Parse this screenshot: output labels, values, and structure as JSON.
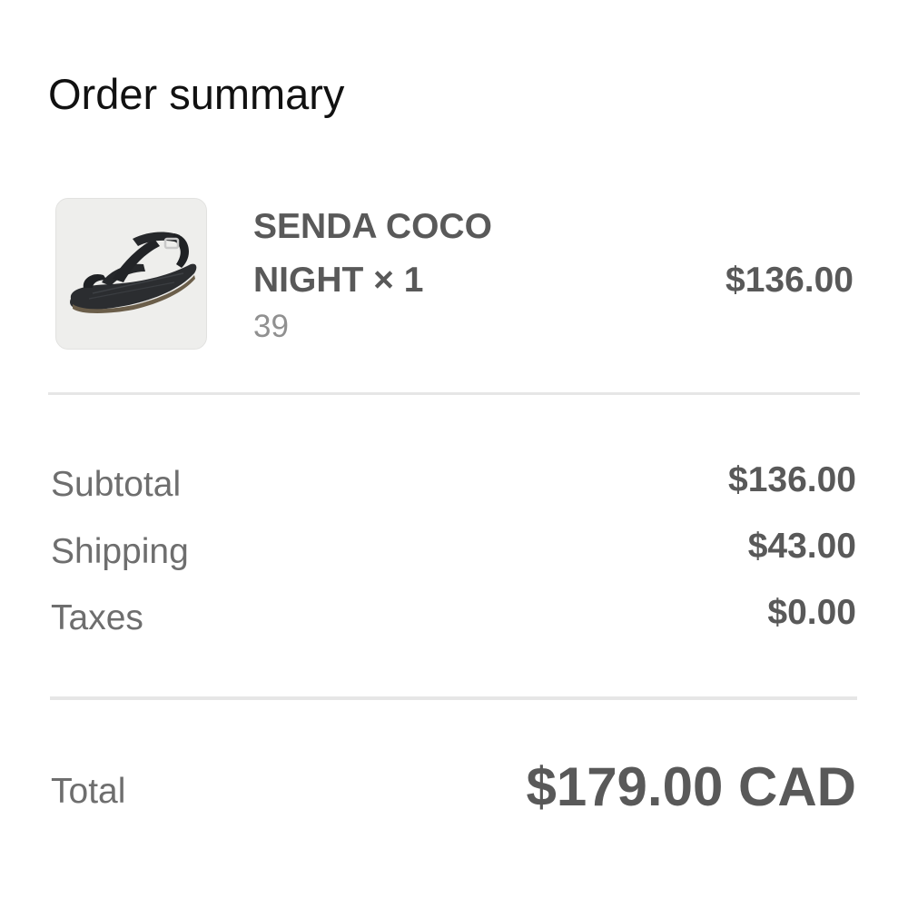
{
  "order_summary": {
    "title": "Order summary",
    "item": {
      "name": "SENDA COCO NIGHT × 1",
      "variant": "39",
      "price": "$136.00",
      "image_icon": "sandal-product-image"
    },
    "subtotal": {
      "label": "Subtotal",
      "value": "$136.00"
    },
    "shipping": {
      "label": "Shipping",
      "value": "$43.00"
    },
    "taxes": {
      "label": "Taxes",
      "value": "$0.00"
    },
    "total": {
      "label": "Total",
      "value": "$179.00 CAD"
    }
  },
  "colors": {
    "primary_text": "#595959",
    "secondary_text": "#6e6e6e",
    "muted_text": "#909090",
    "divider": "#e6e6e6"
  }
}
